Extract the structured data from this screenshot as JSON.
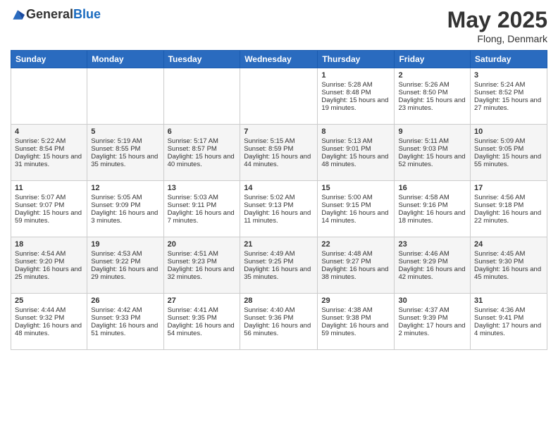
{
  "header": {
    "logo_general": "General",
    "logo_blue": "Blue",
    "month_year": "May 2025",
    "location": "Flong, Denmark"
  },
  "weekdays": [
    "Sunday",
    "Monday",
    "Tuesday",
    "Wednesday",
    "Thursday",
    "Friday",
    "Saturday"
  ],
  "weeks": [
    [
      {
        "day": "",
        "sunrise": "",
        "sunset": "",
        "daylight": ""
      },
      {
        "day": "",
        "sunrise": "",
        "sunset": "",
        "daylight": ""
      },
      {
        "day": "",
        "sunrise": "",
        "sunset": "",
        "daylight": ""
      },
      {
        "day": "",
        "sunrise": "",
        "sunset": "",
        "daylight": ""
      },
      {
        "day": "1",
        "sunrise": "Sunrise: 5:28 AM",
        "sunset": "Sunset: 8:48 PM",
        "daylight": "Daylight: 15 hours and 19 minutes."
      },
      {
        "day": "2",
        "sunrise": "Sunrise: 5:26 AM",
        "sunset": "Sunset: 8:50 PM",
        "daylight": "Daylight: 15 hours and 23 minutes."
      },
      {
        "day": "3",
        "sunrise": "Sunrise: 5:24 AM",
        "sunset": "Sunset: 8:52 PM",
        "daylight": "Daylight: 15 hours and 27 minutes."
      }
    ],
    [
      {
        "day": "4",
        "sunrise": "Sunrise: 5:22 AM",
        "sunset": "Sunset: 8:54 PM",
        "daylight": "Daylight: 15 hours and 31 minutes."
      },
      {
        "day": "5",
        "sunrise": "Sunrise: 5:19 AM",
        "sunset": "Sunset: 8:55 PM",
        "daylight": "Daylight: 15 hours and 35 minutes."
      },
      {
        "day": "6",
        "sunrise": "Sunrise: 5:17 AM",
        "sunset": "Sunset: 8:57 PM",
        "daylight": "Daylight: 15 hours and 40 minutes."
      },
      {
        "day": "7",
        "sunrise": "Sunrise: 5:15 AM",
        "sunset": "Sunset: 8:59 PM",
        "daylight": "Daylight: 15 hours and 44 minutes."
      },
      {
        "day": "8",
        "sunrise": "Sunrise: 5:13 AM",
        "sunset": "Sunset: 9:01 PM",
        "daylight": "Daylight: 15 hours and 48 minutes."
      },
      {
        "day": "9",
        "sunrise": "Sunrise: 5:11 AM",
        "sunset": "Sunset: 9:03 PM",
        "daylight": "Daylight: 15 hours and 52 minutes."
      },
      {
        "day": "10",
        "sunrise": "Sunrise: 5:09 AM",
        "sunset": "Sunset: 9:05 PM",
        "daylight": "Daylight: 15 hours and 55 minutes."
      }
    ],
    [
      {
        "day": "11",
        "sunrise": "Sunrise: 5:07 AM",
        "sunset": "Sunset: 9:07 PM",
        "daylight": "Daylight: 15 hours and 59 minutes."
      },
      {
        "day": "12",
        "sunrise": "Sunrise: 5:05 AM",
        "sunset": "Sunset: 9:09 PM",
        "daylight": "Daylight: 16 hours and 3 minutes."
      },
      {
        "day": "13",
        "sunrise": "Sunrise: 5:03 AM",
        "sunset": "Sunset: 9:11 PM",
        "daylight": "Daylight: 16 hours and 7 minutes."
      },
      {
        "day": "14",
        "sunrise": "Sunrise: 5:02 AM",
        "sunset": "Sunset: 9:13 PM",
        "daylight": "Daylight: 16 hours and 11 minutes."
      },
      {
        "day": "15",
        "sunrise": "Sunrise: 5:00 AM",
        "sunset": "Sunset: 9:15 PM",
        "daylight": "Daylight: 16 hours and 14 minutes."
      },
      {
        "day": "16",
        "sunrise": "Sunrise: 4:58 AM",
        "sunset": "Sunset: 9:16 PM",
        "daylight": "Daylight: 16 hours and 18 minutes."
      },
      {
        "day": "17",
        "sunrise": "Sunrise: 4:56 AM",
        "sunset": "Sunset: 9:18 PM",
        "daylight": "Daylight: 16 hours and 22 minutes."
      }
    ],
    [
      {
        "day": "18",
        "sunrise": "Sunrise: 4:54 AM",
        "sunset": "Sunset: 9:20 PM",
        "daylight": "Daylight: 16 hours and 25 minutes."
      },
      {
        "day": "19",
        "sunrise": "Sunrise: 4:53 AM",
        "sunset": "Sunset: 9:22 PM",
        "daylight": "Daylight: 16 hours and 29 minutes."
      },
      {
        "day": "20",
        "sunrise": "Sunrise: 4:51 AM",
        "sunset": "Sunset: 9:23 PM",
        "daylight": "Daylight: 16 hours and 32 minutes."
      },
      {
        "day": "21",
        "sunrise": "Sunrise: 4:49 AM",
        "sunset": "Sunset: 9:25 PM",
        "daylight": "Daylight: 16 hours and 35 minutes."
      },
      {
        "day": "22",
        "sunrise": "Sunrise: 4:48 AM",
        "sunset": "Sunset: 9:27 PM",
        "daylight": "Daylight: 16 hours and 38 minutes."
      },
      {
        "day": "23",
        "sunrise": "Sunrise: 4:46 AM",
        "sunset": "Sunset: 9:29 PM",
        "daylight": "Daylight: 16 hours and 42 minutes."
      },
      {
        "day": "24",
        "sunrise": "Sunrise: 4:45 AM",
        "sunset": "Sunset: 9:30 PM",
        "daylight": "Daylight: 16 hours and 45 minutes."
      }
    ],
    [
      {
        "day": "25",
        "sunrise": "Sunrise: 4:44 AM",
        "sunset": "Sunset: 9:32 PM",
        "daylight": "Daylight: 16 hours and 48 minutes."
      },
      {
        "day": "26",
        "sunrise": "Sunrise: 4:42 AM",
        "sunset": "Sunset: 9:33 PM",
        "daylight": "Daylight: 16 hours and 51 minutes."
      },
      {
        "day": "27",
        "sunrise": "Sunrise: 4:41 AM",
        "sunset": "Sunset: 9:35 PM",
        "daylight": "Daylight: 16 hours and 54 minutes."
      },
      {
        "day": "28",
        "sunrise": "Sunrise: 4:40 AM",
        "sunset": "Sunset: 9:36 PM",
        "daylight": "Daylight: 16 hours and 56 minutes."
      },
      {
        "day": "29",
        "sunrise": "Sunrise: 4:38 AM",
        "sunset": "Sunset: 9:38 PM",
        "daylight": "Daylight: 16 hours and 59 minutes."
      },
      {
        "day": "30",
        "sunrise": "Sunrise: 4:37 AM",
        "sunset": "Sunset: 9:39 PM",
        "daylight": "Daylight: 17 hours and 2 minutes."
      },
      {
        "day": "31",
        "sunrise": "Sunrise: 4:36 AM",
        "sunset": "Sunset: 9:41 PM",
        "daylight": "Daylight: 17 hours and 4 minutes."
      }
    ]
  ]
}
